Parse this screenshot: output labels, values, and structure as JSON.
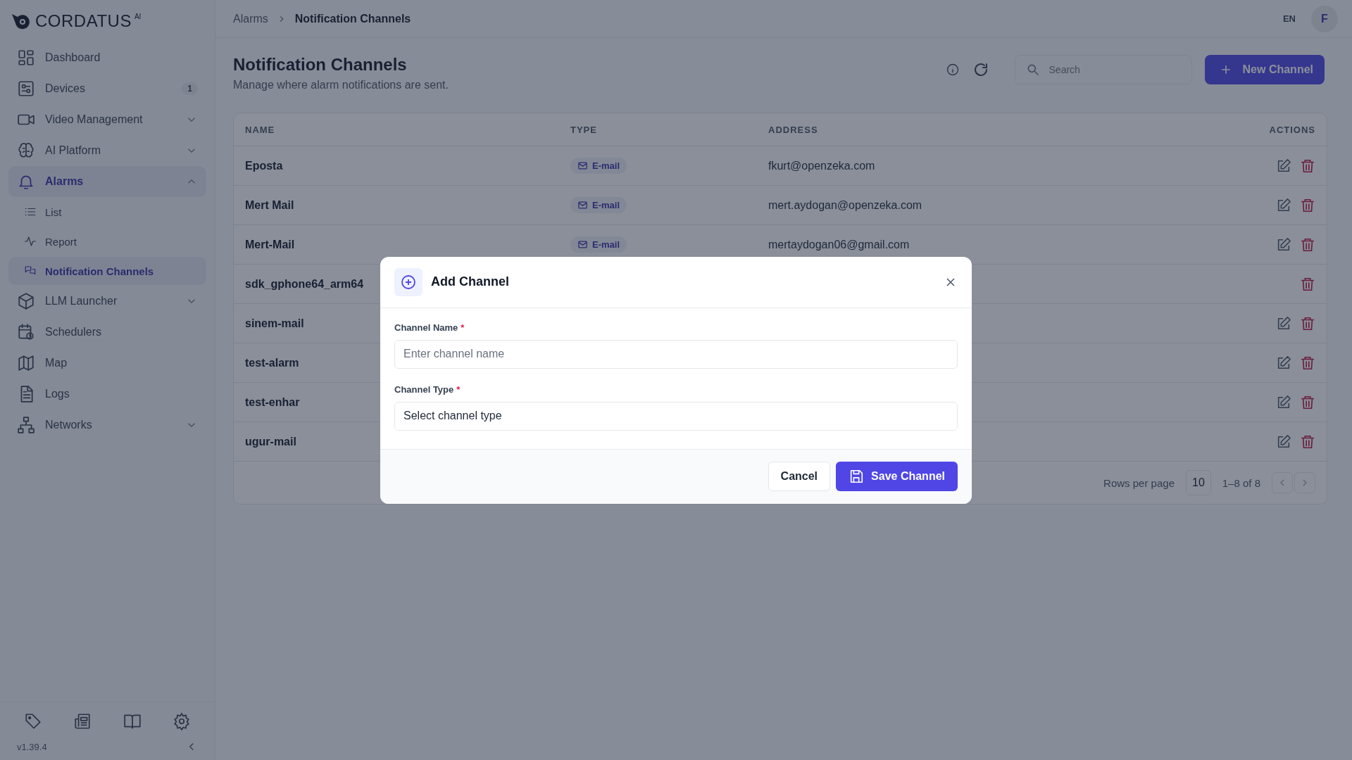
{
  "brand": {
    "name": "CORDATUS",
    "suffix": "AI"
  },
  "sidebar": {
    "items": [
      {
        "label": "Dashboard",
        "selected": false
      },
      {
        "label": "Devices",
        "selected": false,
        "badge": "1"
      },
      {
        "label": "Video Management",
        "selected": false,
        "expanded": false
      },
      {
        "label": "AI Platform",
        "selected": false,
        "expanded": false
      },
      {
        "label": "Alarms",
        "selected": true,
        "expanded": true,
        "children": [
          {
            "label": "List",
            "selected": false
          },
          {
            "label": "Report",
            "selected": false
          },
          {
            "label": "Notification Channels",
            "selected": true
          }
        ]
      },
      {
        "label": "LLM Launcher",
        "selected": false,
        "expanded": false
      },
      {
        "label": "Schedulers",
        "selected": false
      },
      {
        "label": "Map",
        "selected": false
      },
      {
        "label": "Logs",
        "selected": false
      },
      {
        "label": "Networks",
        "selected": false,
        "expanded": false
      }
    ],
    "version": "v1.39.4"
  },
  "header": {
    "breadcrumb": [
      "Alarms",
      "Notification Channels"
    ],
    "language": "EN",
    "avatar": "F"
  },
  "page": {
    "title": "Notification Channels",
    "subtitle": "Manage where alarm notifications are sent.",
    "search": {
      "placeholder": "Search"
    },
    "new_button": "New Channel"
  },
  "table": {
    "columns": [
      "NAME",
      "TYPE",
      "ADDRESS",
      "ACTIONS"
    ],
    "rows": [
      {
        "name": "Eposta",
        "type": "E-mail",
        "address": "fkurt@openzeka.com",
        "editable": true
      },
      {
        "name": "Mert Mail",
        "type": "E-mail",
        "address": "mert.aydogan@openzeka.com",
        "editable": true
      },
      {
        "name": "Mert-Mail",
        "type": "E-mail",
        "address": "mertaydogan06@gmail.com",
        "editable": true
      },
      {
        "name": "sdk_gphone64_arm64",
        "editable": false
      },
      {
        "name": "sinem-mail",
        "editable": true
      },
      {
        "name": "test-alarm",
        "editable": true
      },
      {
        "name": "test-enhar",
        "editable": true
      },
      {
        "name": "ugur-mail",
        "editable": true
      }
    ],
    "pagination": {
      "rows_per_page_label": "Rows per page",
      "rows_per_page": "10",
      "range": "1–8 of 8"
    }
  },
  "modal": {
    "title": "Add Channel",
    "fields": [
      {
        "kind": "text",
        "label": "Channel Name",
        "required_mark": "*",
        "placeholder": "Enter channel name"
      },
      {
        "kind": "select",
        "label": "Channel Type",
        "required_mark": "*",
        "placeholder": "Select channel type"
      }
    ],
    "cancel": "Cancel",
    "save": "Save Channel"
  }
}
